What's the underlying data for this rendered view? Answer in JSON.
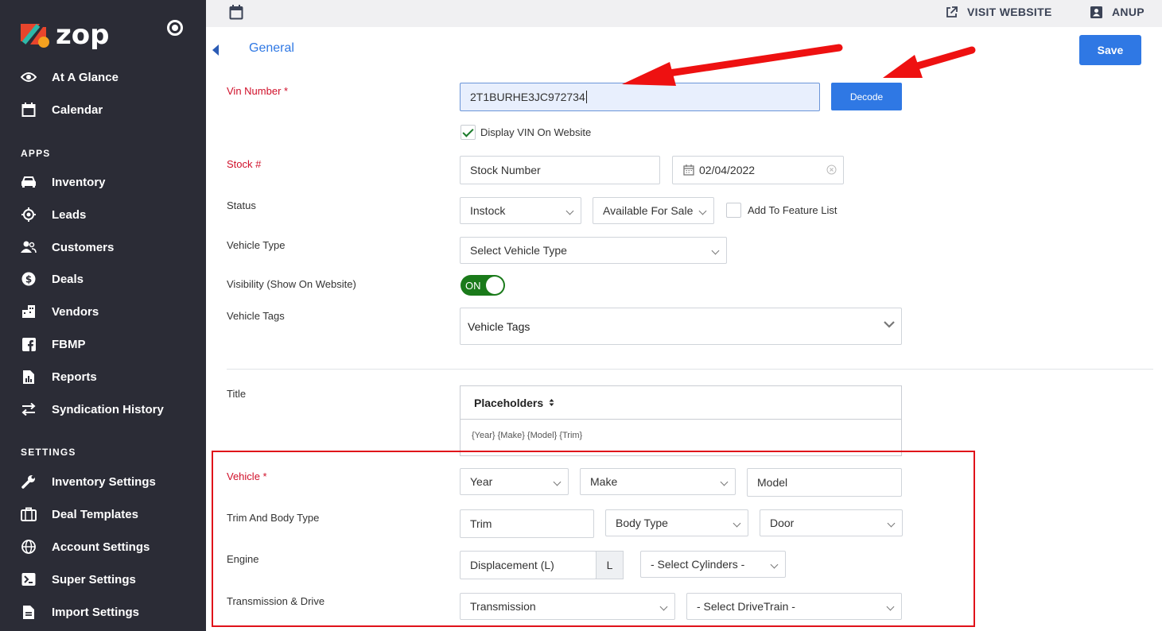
{
  "brand": {
    "name": "zop",
    "colors": {
      "red": "#e8452c",
      "teal": "#2fb8a9",
      "sidebar": "#2b2c36",
      "primary": "#2f78e4"
    }
  },
  "sidebar": {
    "top_items": [
      {
        "label": "At A Glance",
        "icon": "eye-icon"
      },
      {
        "label": "Calendar",
        "icon": "calendar-icon"
      }
    ],
    "apps_label": "APPS",
    "apps_items": [
      {
        "label": "Inventory",
        "icon": "car-icon"
      },
      {
        "label": "Leads",
        "icon": "target-icon"
      },
      {
        "label": "Customers",
        "icon": "users-icon"
      },
      {
        "label": "Deals",
        "icon": "dollar-icon"
      },
      {
        "label": "Vendors",
        "icon": "building-icon"
      },
      {
        "label": "FBMP",
        "icon": "facebook-icon"
      },
      {
        "label": "Reports",
        "icon": "report-icon"
      },
      {
        "label": "Syndication History",
        "icon": "swap-icon"
      }
    ],
    "settings_label": "SETTINGS",
    "settings_items": [
      {
        "label": "Inventory Settings",
        "icon": "wrench-icon"
      },
      {
        "label": "Deal Templates",
        "icon": "briefcase-icon"
      },
      {
        "label": "Account Settings",
        "icon": "globe-icon"
      },
      {
        "label": "Super Settings",
        "icon": "terminal-icon"
      },
      {
        "label": "Import Settings",
        "icon": "document-icon"
      }
    ]
  },
  "header": {
    "visit_website": "VISIT WEBSITE",
    "user": "ANUP"
  },
  "tabs": {
    "active": "General",
    "save_label": "Save"
  },
  "form": {
    "vin_label": "Vin Number *",
    "vin_value": "2T1BURHE3JC972734",
    "decode_label": "Decode",
    "display_vin_label": "Display VIN On Website",
    "display_vin_checked": true,
    "stock_label": "Stock #",
    "stock_placeholder": "Stock Number",
    "stock_date": "02/04/2022",
    "status_label": "Status",
    "status_value": "Instock",
    "availability_value": "Available For Sale",
    "feature_list_label": "Add To Feature List",
    "vehicle_type_label": "Vehicle Type",
    "vehicle_type_value": "Select Vehicle Type",
    "visibility_label": "Visibility (Show On Website)",
    "visibility_toggle": "ON",
    "vehicle_tags_label": "Vehicle Tags",
    "vehicle_tags_value": "Vehicle Tags",
    "title_label": "Title",
    "placeholders_label": "Placeholders",
    "placeholders_text": "{Year} {Make} {Model} {Trim}",
    "vehicle_label": "Vehicle *",
    "year_value": "Year",
    "make_value": "Make",
    "model_value": "Model",
    "trim_body_label": "Trim And Body Type",
    "trim_value": "Trim",
    "body_type_value": "Body Type",
    "door_value": "Door",
    "engine_label": "Engine",
    "displacement_value": "Displacement (L)",
    "displacement_unit": "L",
    "cylinders_value": "- Select Cylinders -",
    "transmission_label": "Transmission & Drive",
    "transmission_value": "Transmission",
    "drivetrain_value": "- Select DriveTrain -"
  }
}
